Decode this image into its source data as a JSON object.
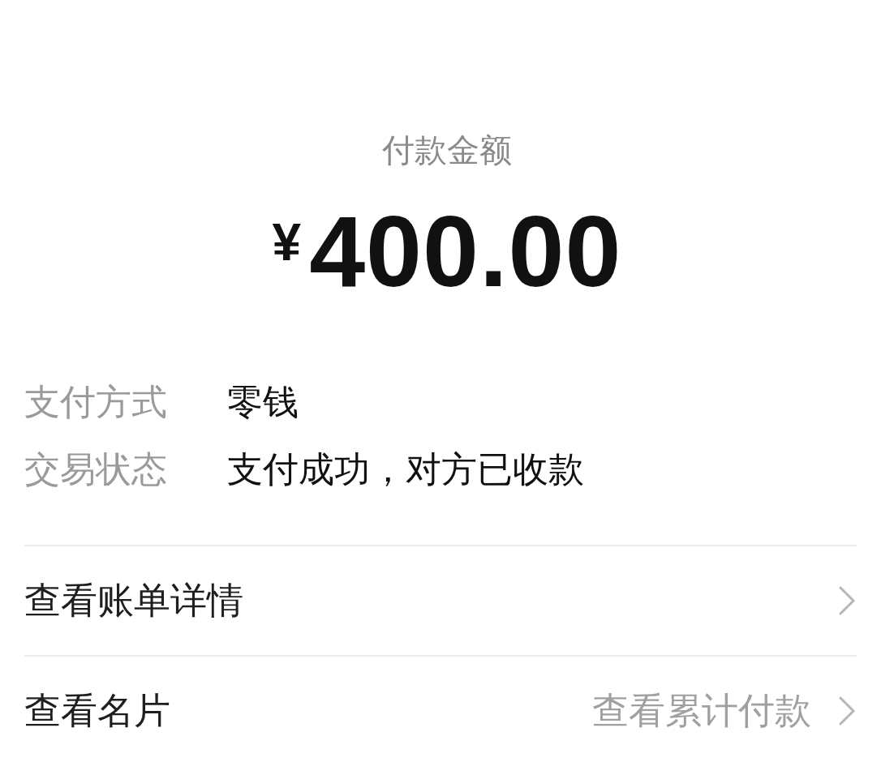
{
  "amount": {
    "label": "付款金额",
    "currency": "¥",
    "value": "400.00"
  },
  "details": [
    {
      "label": "支付方式",
      "value": "零钱"
    },
    {
      "label": "交易状态",
      "value": "支付成功，对方已收款"
    }
  ],
  "links": [
    {
      "label": "查看账单详情"
    },
    {
      "label": "查看名片",
      "hint": "查看累计付款"
    }
  ]
}
